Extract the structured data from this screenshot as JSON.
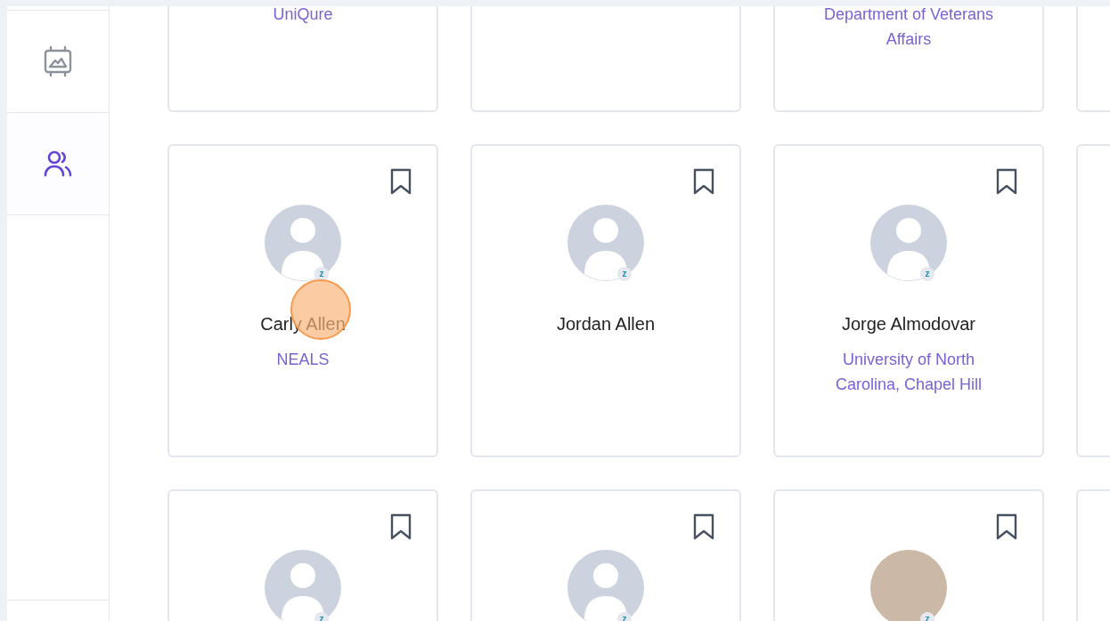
{
  "sidebar": {
    "items": [
      {
        "kind": "presentation",
        "selected": false
      },
      {
        "kind": "people",
        "selected": true
      }
    ]
  },
  "rows": [
    {
      "cards": [
        {
          "kind": "profile",
          "org": "UniQure"
        },
        {
          "kind": "profile"
        },
        {
          "kind": "profile",
          "org": "Department of Veterans Affairs"
        },
        {
          "kind": "cut_off"
        }
      ]
    },
    {
      "cards": [
        {
          "kind": "profile",
          "bookmarked": false,
          "avatar": {
            "kind": "placeholder",
            "status_badge": "z"
          },
          "name": "Carly Allen",
          "org": "NEALS",
          "tapped": true
        },
        {
          "kind": "profile",
          "bookmarked": false,
          "avatar": {
            "kind": "placeholder",
            "status_badge": "z"
          },
          "name": "Jordan Allen",
          "tapped": false
        },
        {
          "kind": "profile",
          "bookmarked": false,
          "avatar": {
            "kind": "placeholder",
            "status_badge": "z"
          },
          "name": "Jorge Almodovar",
          "org": "University of North Carolina, Chapel Hill",
          "tapped": false
        },
        {
          "kind": "cut_off"
        }
      ]
    },
    {
      "cards": [
        {
          "kind": "profile",
          "bookmarked": false,
          "avatar": {
            "kind": "placeholder",
            "status_badge": "z"
          }
        },
        {
          "kind": "profile",
          "bookmarked": false,
          "avatar": {
            "kind": "placeholder",
            "status_badge": "z"
          }
        },
        {
          "kind": "profile",
          "bookmarked": false,
          "avatar": {
            "kind": "photo",
            "status_badge": "z"
          }
        },
        {
          "kind": "cut_off"
        }
      ]
    }
  ]
}
